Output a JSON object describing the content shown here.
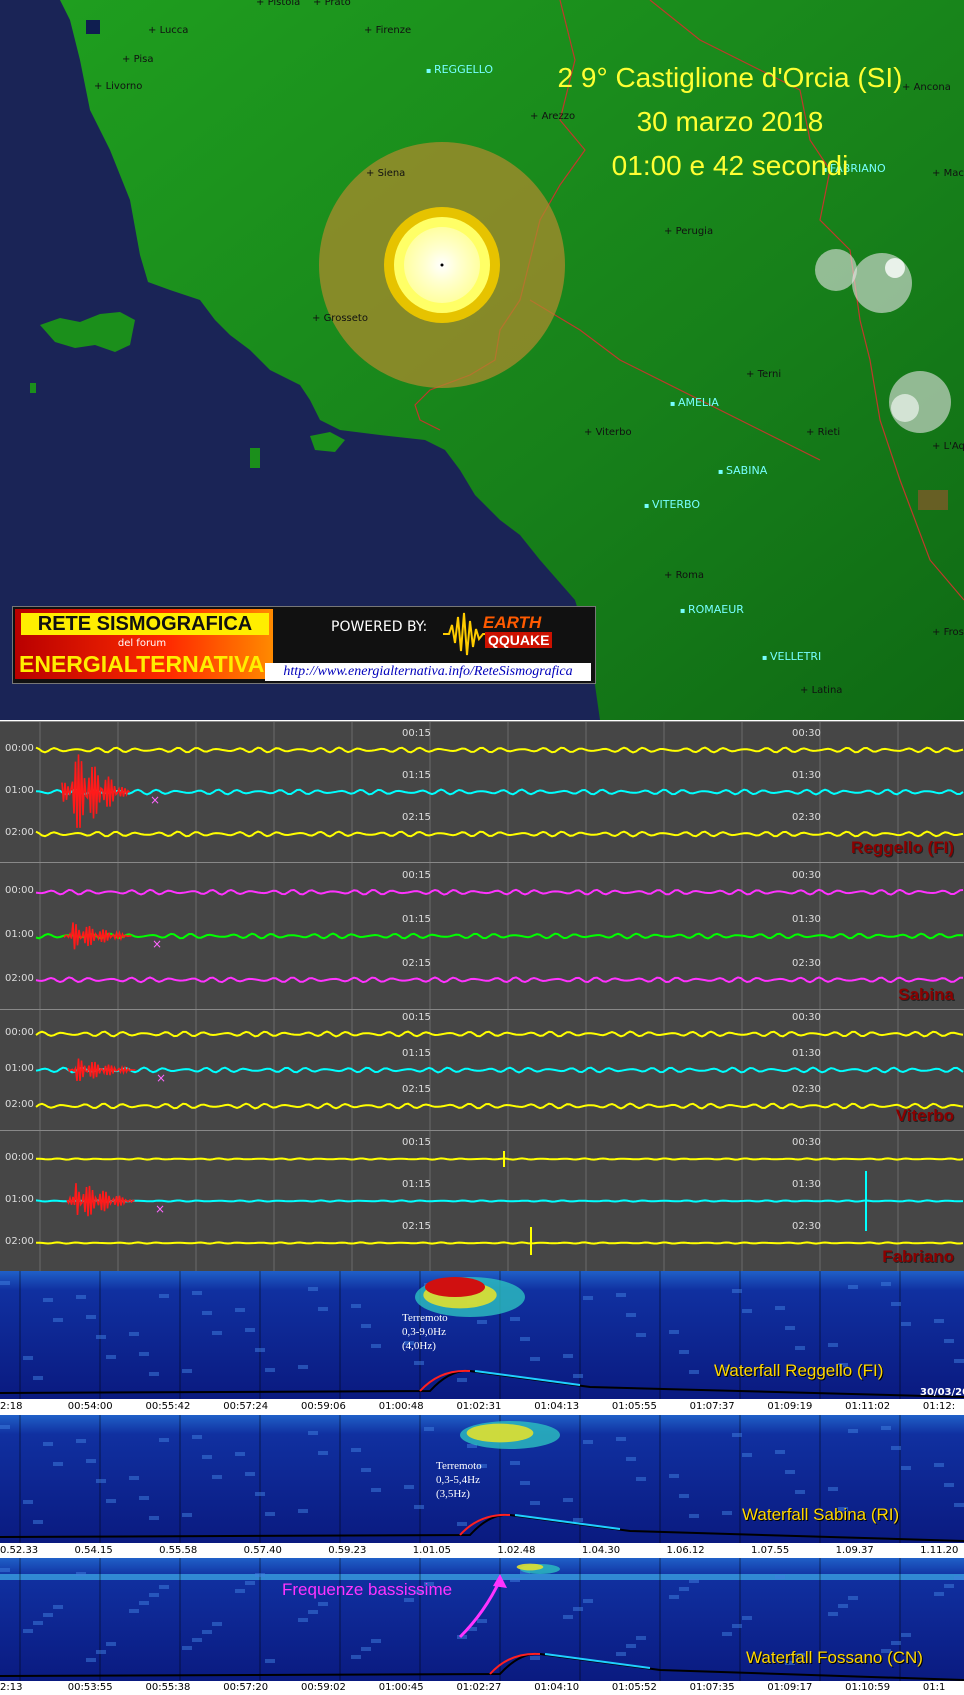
{
  "map": {
    "title_line1": "2 9° Castiglione d'Orcia (SI)",
    "title_line2": "30 marzo 2018",
    "title_line3": "01:00 e 42 secondi",
    "cities": [
      "Pistoia",
      "Prato",
      "Lucca",
      "Firenze",
      "Pisa",
      "Livorno",
      "Arezzo",
      "Siena",
      "Perugia",
      "Grosseto",
      "Terni",
      "Viterbo",
      "Rieti",
      "Roma",
      "Latina",
      "Macerata",
      "L'Aquila",
      "Ancona",
      "Frosinone"
    ],
    "stations": [
      "REGGELLO",
      "FABRIANO",
      "AMELIA",
      "SABINA",
      "VITERBO",
      "ROMAEUR",
      "VELLETRI"
    ],
    "colors": {
      "sea": "#1a2456",
      "land": "#1e9a1e",
      "epicenter": "#ffffcc",
      "rings": "#e6c300"
    }
  },
  "logo": {
    "line1": "RETE SISMOGRAFICA",
    "line2": "del forum",
    "line3": "ENERGIALTERNATIVA",
    "powered": "POWERED BY:",
    "brand1": "EARTH",
    "brand2": "QQUAKE",
    "url": "http://www.energialternativa.info/ReteSismografica"
  },
  "helicorders": [
    {
      "name": "Reggello (FI)",
      "rows": [
        "00:00",
        "01:00",
        "02:00"
      ],
      "mid": [
        "00:15",
        "01:15",
        "02:15"
      ],
      "right": [
        "00:30",
        "01:30",
        "02:30"
      ],
      "colors": [
        "#ffff00",
        "#00ffff",
        "#ffff00"
      ]
    },
    {
      "name": "Sabina",
      "rows": [
        "00:00",
        "01:00",
        "02:00"
      ],
      "mid": [
        "00:15",
        "01:15",
        "02:15"
      ],
      "right": [
        "00:30",
        "01:30",
        "02:30"
      ],
      "colors": [
        "#ff33ff",
        "#00ff00",
        "#ff33ff"
      ]
    },
    {
      "name": "Viterbo",
      "rows": [
        "00:00",
        "01:00",
        "02:00"
      ],
      "mid": [
        "00:15",
        "01:15",
        "02:15"
      ],
      "right": [
        "00:30",
        "01:30",
        "02:30"
      ],
      "colors": [
        "#ffff00",
        "#00ffff",
        "#ffff00"
      ]
    },
    {
      "name": "Fabriano",
      "rows": [
        "00:00",
        "01:00",
        "02:00"
      ],
      "mid": [
        "00:15",
        "01:15",
        "02:15"
      ],
      "right": [
        "00:30",
        "01:30",
        "02:30"
      ],
      "colors": [
        "#ffff00",
        "#00ffff",
        "#ffff00"
      ]
    }
  ],
  "waterfalls": [
    {
      "name": "Waterfall Reggello (FI)",
      "note1": "Terremoto",
      "note2": "0,3-9,0Hz",
      "note3": "(4,0Hz)",
      "date": "30/03/20"
    },
    {
      "name": "Waterfall Sabina (RI)",
      "note1": "Terremoto",
      "note2": "0,3-5,4Hz",
      "note3": "(3,5Hz)",
      "date": ""
    },
    {
      "name": "Waterfall Fossano (CN)",
      "note1": "Frequenze bassissime",
      "note2": "",
      "note3": "",
      "date": ""
    }
  ],
  "ticks1": [
    "2:18",
    "00:54:00",
    "00:55:42",
    "00:57:24",
    "00:59:06",
    "01:00:48",
    "01:02:31",
    "01:04:13",
    "01:05:55",
    "01:07:37",
    "01:09:19",
    "01:11:02",
    "01:12:"
  ],
  "ticks2": [
    "0.52.33",
    "0.54.15",
    "0.55.58",
    "0.57.40",
    "0.59.23",
    "1.01.05",
    "1.02.48",
    "1.04.30",
    "1.06.12",
    "1.07.55",
    "1.09.37",
    "1.11.20"
  ],
  "ticks3": [
    "2:13",
    "00:53:55",
    "00:55:38",
    "00:57:20",
    "00:59:02",
    "01:00:45",
    "01:02:27",
    "01:04:10",
    "01:05:52",
    "01:07:35",
    "01:09:17",
    "01:10:59",
    "01:1"
  ]
}
